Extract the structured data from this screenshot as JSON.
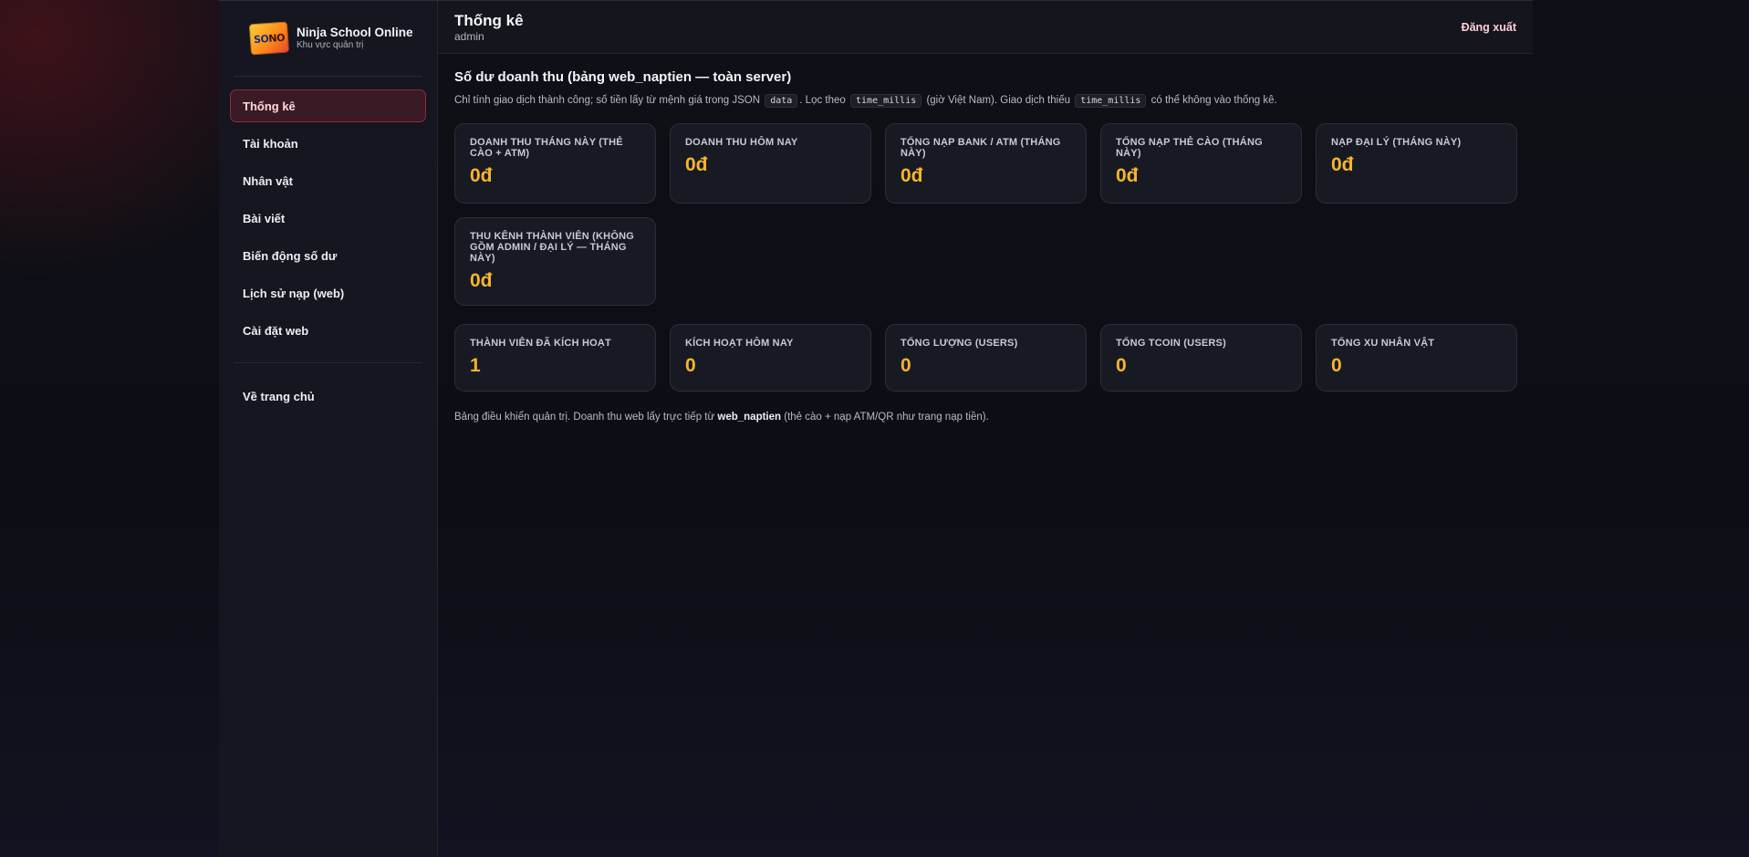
{
  "brand": {
    "title": "Ninja School Online",
    "subtitle": "Khu vực quản trị"
  },
  "sidebar": {
    "items": [
      {
        "label": "Thống kê",
        "active": true
      },
      {
        "label": "Tài khoản"
      },
      {
        "label": "Nhân vật"
      },
      {
        "label": "Bài viết"
      },
      {
        "label": "Biến động số dư"
      },
      {
        "label": "Lịch sử nạp (web)"
      },
      {
        "label": "Cài đặt web"
      }
    ],
    "home_label": "Về trang chủ"
  },
  "header": {
    "title": "Thống kê",
    "user": "admin",
    "logout_label": "Đăng xuất"
  },
  "section": {
    "title": "Số dư doanh thu (bảng web_naptien — toàn server)",
    "desc_part1": "Chỉ tính giao dịch thành công; số tiền lấy từ mệnh giá trong JSON",
    "code1": "data",
    "desc_part2": ". Lọc theo",
    "code2": "time_millis",
    "desc_part3": "(giờ Việt Nam). Giao dịch thiếu",
    "code3": "time_millis",
    "desc_part4": "có thể không vào thống kê."
  },
  "revenue_cards": [
    {
      "label": "Doanh thu tháng này (thẻ cào + ATM)",
      "value": "0đ"
    },
    {
      "label": "Doanh thu hôm nay",
      "value": "0đ"
    },
    {
      "label": "Tổng nạp bank / ATM (tháng này)",
      "value": "0đ"
    },
    {
      "label": "Tổng nạp thẻ cào (tháng này)",
      "value": "0đ"
    },
    {
      "label": "Nạp đại lý (tháng này)",
      "value": "0đ"
    },
    {
      "label": "Thu kênh thành viên (không gồm admin / đại lý — tháng này)",
      "value": "0đ"
    }
  ],
  "user_cards": [
    {
      "label": "Thành viên đã kích hoạt",
      "value": "1"
    },
    {
      "label": "Kích hoạt hôm nay",
      "value": "0"
    },
    {
      "label": "Tổng lượng (users)",
      "value": "0"
    },
    {
      "label": "Tổng tcoin (users)",
      "value": "0"
    },
    {
      "label": "Tổng xu nhân vật",
      "value": "0"
    }
  ],
  "footnote": {
    "part1": "Bảng điều khiển quản trị. Doanh thu web lấy trực tiếp từ",
    "bold": "web_naptien",
    "part2": "(thẻ cào + nạp ATM/QR như trang nạp tiền)."
  },
  "colors": {
    "accent_value": "#f6b52e",
    "active_nav_bg": "#3a1a24",
    "active_nav_border": "#8c2b3d"
  }
}
